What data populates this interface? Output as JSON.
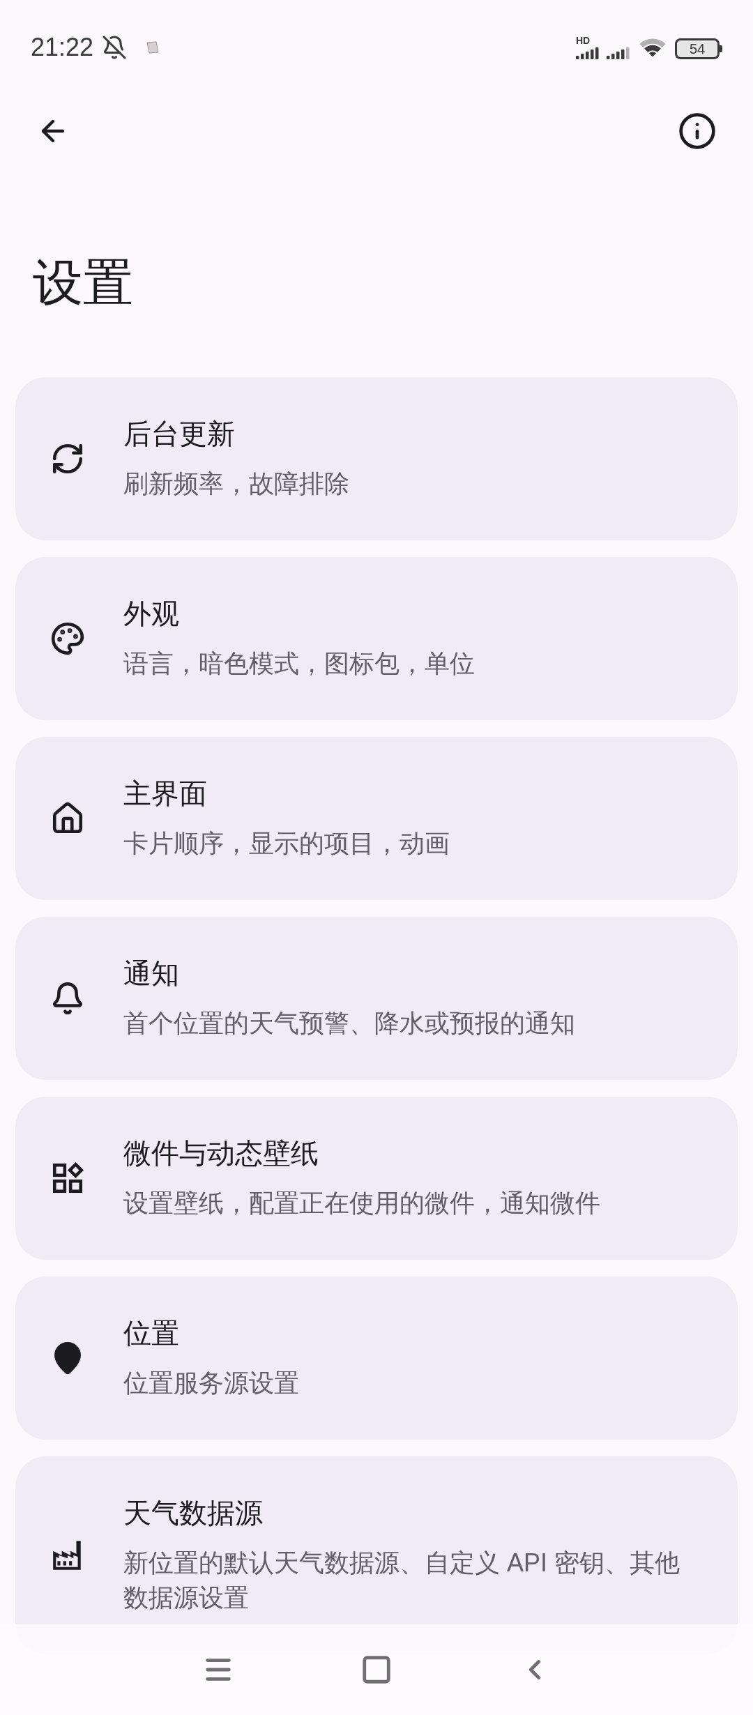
{
  "status_bar": {
    "time": "21:22",
    "network_label": "HD",
    "battery": "54"
  },
  "title": "设置",
  "items": [
    {
      "title": "后台更新",
      "subtitle": "刷新频率，故障排除"
    },
    {
      "title": "外观",
      "subtitle": "语言，暗色模式，图标包，单位"
    },
    {
      "title": "主界面",
      "subtitle": "卡片顺序，显示的项目，动画"
    },
    {
      "title": "通知",
      "subtitle": "首个位置的天气预警、降水或预报的通知"
    },
    {
      "title": "微件与动态壁纸",
      "subtitle": "设置壁纸，配置正在使用的微件，通知微件"
    },
    {
      "title": "位置",
      "subtitle": "位置服务源设置"
    },
    {
      "title": "天气数据源",
      "subtitle": "新位置的默认天气数据源、自定义 API 密钥、其他数据源设置"
    }
  ]
}
